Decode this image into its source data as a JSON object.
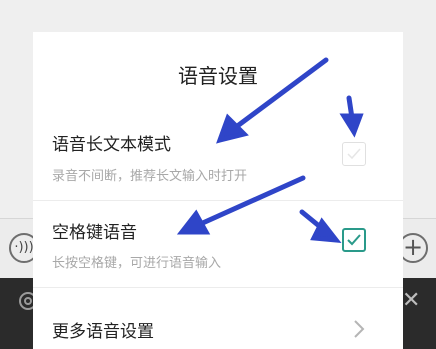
{
  "dialog": {
    "title": "语音设置",
    "options": [
      {
        "title": "语音长文本模式",
        "description": "录音不间断，推荐长文输入时打开",
        "checked": false
      },
      {
        "title": "空格键语音",
        "description": "长按空格键，可进行语音输入",
        "checked": true
      }
    ],
    "more_settings_label": "更多语音设置"
  },
  "background": {
    "voice_button_glyph": "·)))",
    "plus_button_glyph": "+",
    "close_glyph": "✕"
  },
  "icons": {
    "settings": "gear-icon",
    "close": "close-icon",
    "check": "check-icon",
    "chevron": "chevron-right-icon"
  },
  "colors": {
    "accent": "#2a9a8a",
    "arrow": "#2f45c8",
    "bottom_bar": "#2b2b2b"
  }
}
